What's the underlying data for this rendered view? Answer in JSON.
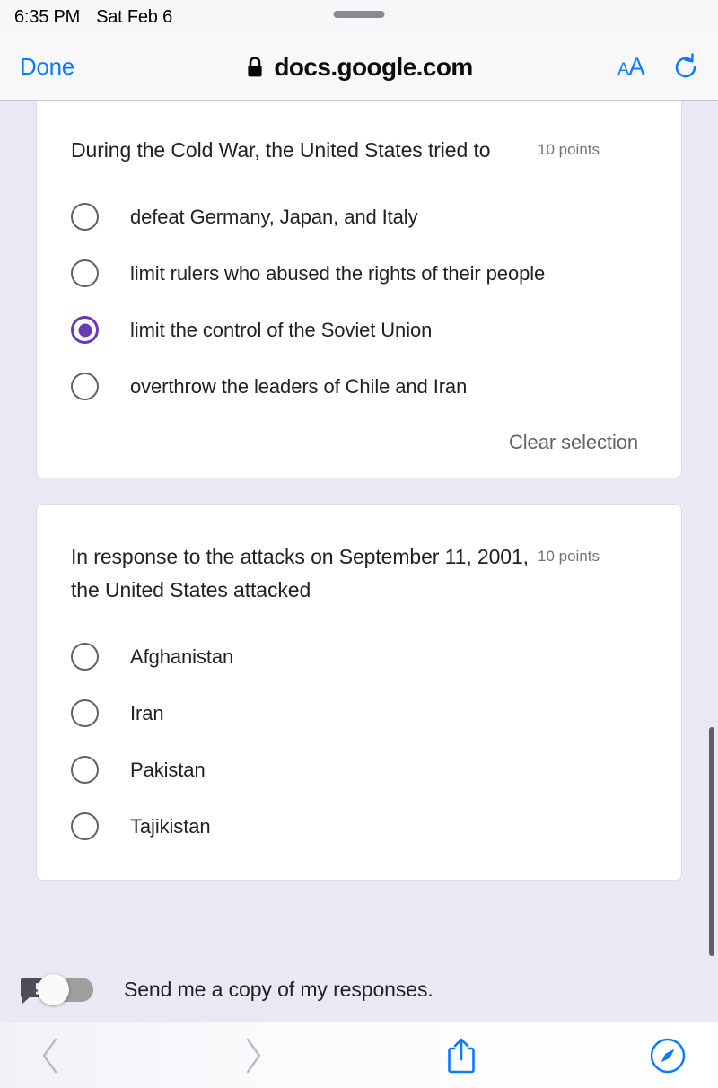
{
  "status_bar": {
    "time": "6:35 PM",
    "date": "Sat Feb 6",
    "grabber": "grabber-handle"
  },
  "browser": {
    "done_label": "Done",
    "lock_icon": "lock-icon",
    "url": "docs.google.com",
    "text_size_small": "A",
    "text_size_large": "A",
    "reload_icon": "reload-icon",
    "accent_color": "#0a7aff"
  },
  "form": {
    "background_color": "#eae8f5",
    "card_color": "#ffffff",
    "selected_color": "#673ab7",
    "questions": [
      {
        "title": "During the Cold War, the United States tried to",
        "points": "10 points",
        "options": [
          {
            "label": "defeat Germany, Japan, and Italy",
            "selected": false
          },
          {
            "label": "limit rulers who abused the rights of their people",
            "selected": false
          },
          {
            "label": "limit the control of the Soviet Union",
            "selected": true
          },
          {
            "label": "overthrow the leaders of Chile and Iran",
            "selected": false
          }
        ],
        "clear_label": "Clear selection",
        "has_clear": true
      },
      {
        "title": "In response to the attacks on September 11, 2001, the United States attacked",
        "points": "10 points",
        "options": [
          {
            "label": "Afghanistan",
            "selected": false
          },
          {
            "label": "Iran",
            "selected": false
          },
          {
            "label": "Pakistan",
            "selected": false
          },
          {
            "label": "Tajikistan",
            "selected": false
          }
        ],
        "clear_label": "",
        "has_clear": false
      }
    ],
    "copy_toggle": {
      "label": "Send me a copy of my responses.",
      "state": "off",
      "badge_icon": "alert-bubble-icon"
    }
  },
  "toolbar": {
    "back_icon": "back-chevron-icon",
    "forward_icon": "forward-chevron-icon",
    "share_icon": "share-icon",
    "compass_icon": "safari-compass-icon",
    "disabled_color": "#b9b9bf",
    "enabled_color": "#0a7aff"
  }
}
